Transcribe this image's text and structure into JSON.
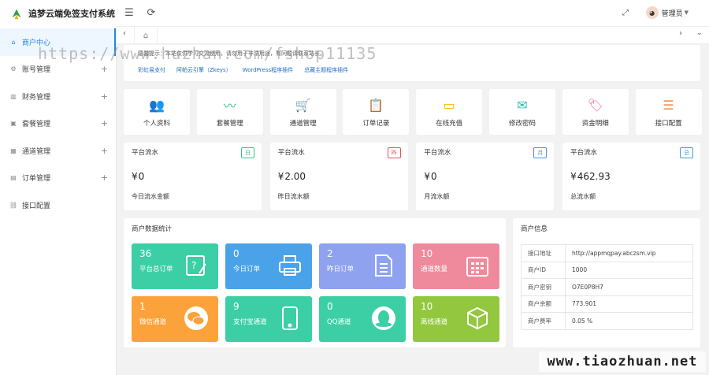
{
  "app": {
    "title": "追梦云端免签支付系统"
  },
  "header": {
    "admin_label": "管理员"
  },
  "sidebar": {
    "items": [
      {
        "label": "商户中心",
        "icon": "home-icon",
        "active": true,
        "expandable": false
      },
      {
        "label": "账号管理",
        "icon": "gear-icon",
        "active": false,
        "expandable": true
      },
      {
        "label": "财务管理",
        "icon": "chart-icon",
        "active": false,
        "expandable": true
      },
      {
        "label": "套餐管理",
        "icon": "box-icon",
        "active": false,
        "expandable": true
      },
      {
        "label": "通道管理",
        "icon": "grid-icon",
        "active": false,
        "expandable": true
      },
      {
        "label": "订单管理",
        "icon": "order-icon",
        "active": false,
        "expandable": true
      },
      {
        "label": "接口配置",
        "icon": "link-icon",
        "active": false,
        "expandable": false
      }
    ]
  },
  "notice": {
    "text": "温馨提示：本站仅供学习交流使用，请勿用于非法用途，有问题请联系站长。",
    "links": [
      "彩虹易支付",
      "阿帕云引擎（Zkeys）",
      "WordPress程序插件",
      "总藏主题程序插件"
    ]
  },
  "quick": [
    {
      "label": "个人资料",
      "icon": "users-icon",
      "color": "#4a90e2"
    },
    {
      "label": "套餐管理",
      "icon": "pulse-icon",
      "color": "#3ac28a"
    },
    {
      "label": "通道管理",
      "icon": "cart-icon",
      "color": "#f08a3c"
    },
    {
      "label": "订单记录",
      "icon": "clipboard-icon",
      "color": "#8e6ad8"
    },
    {
      "label": "在线充值",
      "icon": "card-icon",
      "color": "#f4b400"
    },
    {
      "label": "修改密码",
      "icon": "mail-icon",
      "color": "#1fbfaf"
    },
    {
      "label": "资金明细",
      "icon": "tag-icon",
      "color": "#f06c9b"
    },
    {
      "label": "接口配置",
      "icon": "sliders-icon",
      "color": "#f08a3c"
    }
  ],
  "flow": [
    {
      "title": "平台流水",
      "badge": "日",
      "badge_color": "#3ac28a",
      "currency": "¥",
      "value": "0",
      "sub": "今日流水金额"
    },
    {
      "title": "平台流水",
      "badge": "昨",
      "badge_color": "#e55353",
      "currency": "¥",
      "value": "2.00",
      "sub": "昨日流水额"
    },
    {
      "title": "平台流水",
      "badge": "月",
      "badge_color": "#4a90e2",
      "currency": "¥",
      "value": "0",
      "sub": "月流水额"
    },
    {
      "title": "平台流水",
      "badge": "总",
      "badge_color": "#3b9ed8",
      "currency": "¥",
      "value": "462.93",
      "sub": "总流水额"
    }
  ],
  "stats": {
    "title": "商户数据统计",
    "tiles": [
      {
        "value": "36",
        "label": "平台总订单",
        "color": "#3ccfa6",
        "icon": "edit-doc-icon"
      },
      {
        "value": "0",
        "label": "今日订单",
        "color": "#4aa3e8",
        "icon": "printer-icon"
      },
      {
        "value": "2",
        "label": "昨日订单",
        "color": "#8ea2f0",
        "icon": "list-doc-icon"
      },
      {
        "value": "10",
        "label": "通道数量",
        "color": "#ef8a9c",
        "icon": "calendar-icon"
      },
      {
        "value": "1",
        "label": "微信通道",
        "color": "#fba33a",
        "icon": "wechat-icon"
      },
      {
        "value": "9",
        "label": "支付宝通道",
        "color": "#3ccfa6",
        "icon": "tablet-icon"
      },
      {
        "value": "0",
        "label": "QQ通道",
        "color": "#3ccfa6",
        "icon": "qq-icon"
      },
      {
        "value": "10",
        "label": "离线通道",
        "color": "#93c83e",
        "icon": "cube-icon"
      }
    ]
  },
  "merchant": {
    "title": "商户信息",
    "rows": [
      {
        "k": "接口地址",
        "v": "http://appmqpay.abczsm.vip"
      },
      {
        "k": "商户ID",
        "v": "1000"
      },
      {
        "k": "商户密钥",
        "v": "O7E0P8H7"
      },
      {
        "k": "商户余额",
        "v": "773.901"
      },
      {
        "k": "商户费率",
        "v": "0.05 %"
      }
    ]
  },
  "watermarks": {
    "top": "https://www.huzhan.com/fshop11135",
    "bottom": "www.tiaozhuan.net"
  }
}
